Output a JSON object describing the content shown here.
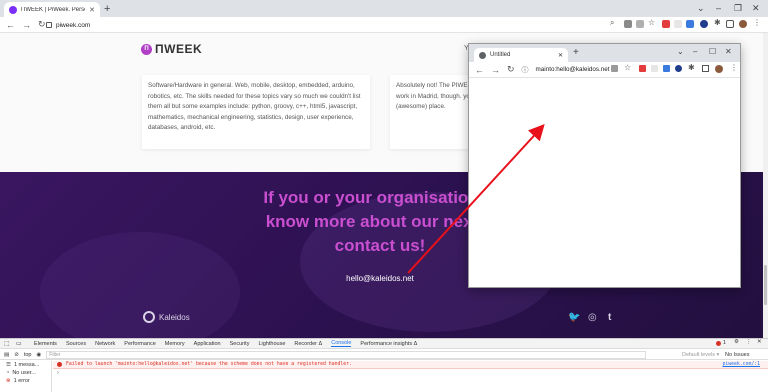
{
  "browser": {
    "tab_title": "ПWEEK | PiWeek. Personal Inno...",
    "url": "piweek.com"
  },
  "page": {
    "logo_text": "ПWEEK",
    "card1_text": "Software/Hardware in general. Web, mobile, desktop, embedded, arduino, robotics, etc. The skills needed for these topics vary so much we couldn't list them all but some examples include: python, groovy, c++, html5, javascript, mathematics, mechanical engineering, statistics, design, user experience, databases, android, etc.",
    "card2_text": "Absolutely not! The PIWEEK work in Madrid, though. you (awesome) place.",
    "headline_line1": "If you or your organisation w",
    "headline_line2": "know more about our next P",
    "headline_line3": "contact us!",
    "email": "hello@kaleidos.net",
    "footer_brand": "Kaleidos",
    "header_initial": "Y"
  },
  "popup": {
    "tab_title": "Untitled",
    "url": "mainto:hello@kaleidos.net"
  },
  "devtools": {
    "tabs": [
      "Elements",
      "Sources",
      "Network",
      "Performance",
      "Memory",
      "Application",
      "Security",
      "Lighthouse",
      "Recorder Δ",
      "Console",
      "Performance insights Δ"
    ],
    "active_tab": "Console",
    "context": "top",
    "filter_placeholder": "Filter",
    "levels": "Default levels ▾",
    "issues": "No Issues",
    "side_items": [
      "1 messa...",
      "No user...",
      "1 error"
    ],
    "error_text": "Failed to launch 'mainto:hello@kaleidos.net' because the scheme does not have a registered handler.",
    "error_source": "piweek.com/:1",
    "error_count": "1"
  },
  "colors": {
    "accent": "#c94fd0",
    "banner": "#2c1150",
    "arrow": "#e8101a"
  }
}
